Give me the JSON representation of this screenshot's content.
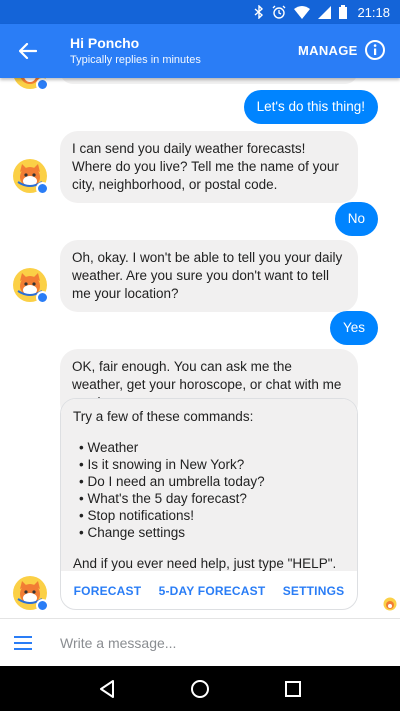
{
  "status_bar": {
    "time": "21:18",
    "icons": [
      "bluetooth-icon",
      "alarm-icon",
      "wifi-icon",
      "signal-icon",
      "battery-icon"
    ]
  },
  "app_bar": {
    "title": "Hi Poncho",
    "subtitle": "Typically replies in minutes",
    "manage_label": "MANAGE",
    "back_icon": "back-arrow-icon",
    "info_icon": "info-icon",
    "color": "#2a7df6"
  },
  "messages": [
    {
      "from": "user",
      "text": "Let's do this thing!"
    },
    {
      "from": "bot",
      "text": "I can send you daily weather forecasts! Where do you live? Tell me the name of your city, neighborhood, or postal code."
    },
    {
      "from": "user",
      "text": "No"
    },
    {
      "from": "bot",
      "text": "Oh, okay. I won't be able to tell you your daily weather. Are you sure you don't want to tell me your location?"
    },
    {
      "from": "user",
      "text": "Yes"
    },
    {
      "from": "bot",
      "text": "OK, fair enough. You can ask me the weather, get your horoscope, or chat with me anytime."
    }
  ],
  "card": {
    "intro": "Try a few of these commands:",
    "commands": [
      "• Weather",
      "• Is it snowing in New York?",
      "• Do I need an umbrella today?",
      "• What's the 5 day forecast?",
      "• Stop notifications!",
      "• Change settings"
    ],
    "outro": "And if you ever need help, just type \"HELP\".",
    "actions": [
      "FORECAST",
      "5-DAY FORECAST",
      "SETTINGS"
    ]
  },
  "composer": {
    "placeholder": "Write a message...",
    "menu_icon": "menu-icon"
  },
  "colors": {
    "accent": "#2a7df6",
    "outgoing_bubble": "#0084ff",
    "incoming_bubble": "#f1f0f0"
  }
}
